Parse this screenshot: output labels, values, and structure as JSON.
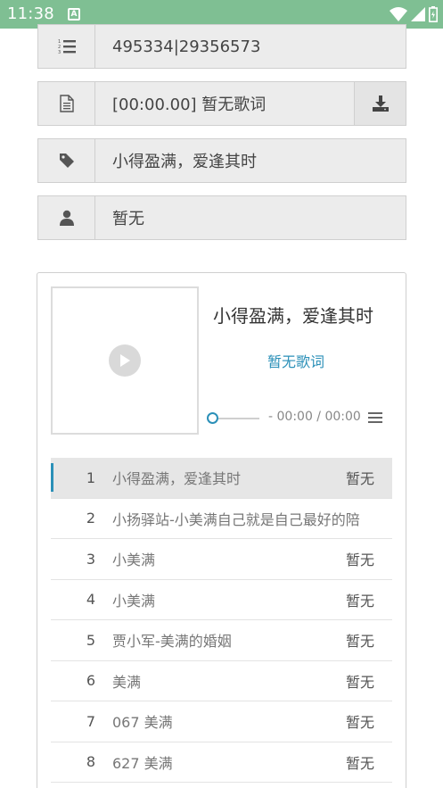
{
  "status_bar": {
    "time": "11:38",
    "badge": "A"
  },
  "info_rows": {
    "id_text": "495334|29356573",
    "lyric_text": "[00:00.00] 暂无歌词",
    "title_text": "小得盈满，爱逢其时",
    "artist_text": "暂无"
  },
  "player": {
    "title": "小得盈满，爱逢其时",
    "lyric_status": "暂无歌词",
    "time_display": "- 00:00 / 00:00",
    "progress_fraction": 0
  },
  "playlist": [
    {
      "index": "1",
      "name": "小得盈满，爱逢其时",
      "artist": "暂无",
      "active": true
    },
    {
      "index": "2",
      "name": "小扬驿站-小美满自己就是自己最好的陪",
      "artist": ""
    },
    {
      "index": "3",
      "name": "小美满",
      "artist": "暂无"
    },
    {
      "index": "4",
      "name": "小美满",
      "artist": "暂无"
    },
    {
      "index": "5",
      "name": "贾小军-美满的婚姻",
      "artist": "暂无"
    },
    {
      "index": "6",
      "name": "美满",
      "artist": "暂无"
    },
    {
      "index": "7",
      "name": "067 美满",
      "artist": "暂无"
    },
    {
      "index": "8",
      "name": "627 美满",
      "artist": "暂无"
    }
  ],
  "colors": {
    "status_bar": "#7fbf93",
    "accent": "#2b90b8",
    "row_bg": "#ececec"
  },
  "icons": [
    "list-ordered-icon",
    "file-text-icon",
    "download-icon",
    "tag-icon",
    "user-icon",
    "play-icon",
    "menu-icon",
    "wifi-icon",
    "signal-icon",
    "battery-icon"
  ]
}
